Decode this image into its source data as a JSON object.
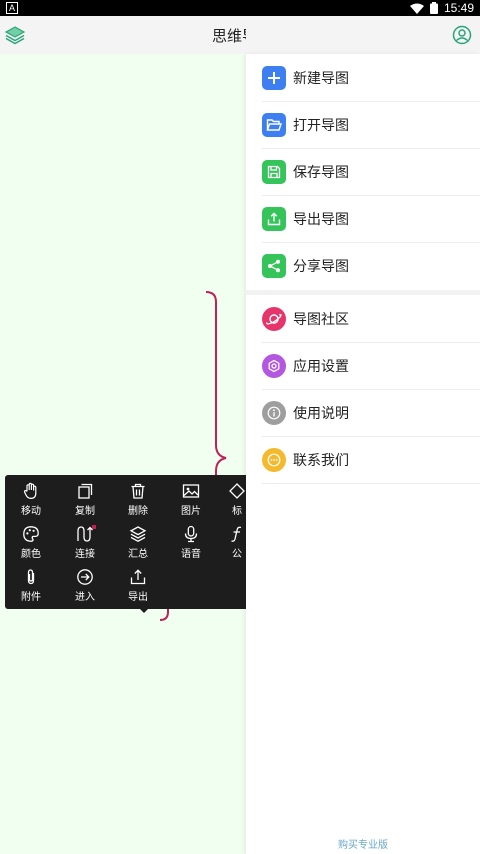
{
  "status_bar": {
    "left_badge": "A",
    "time": "15:49"
  },
  "app_bar": {
    "title": "思维导图",
    "left_icon": "layers-icon",
    "right_icon": "user-icon"
  },
  "toolbar": {
    "items": [
      {
        "label": "移动",
        "icon": "hand-icon"
      },
      {
        "label": "复制",
        "icon": "copy-icon"
      },
      {
        "label": "删除",
        "icon": "trash-icon"
      },
      {
        "label": "图片",
        "icon": "image-icon"
      },
      {
        "label": "标",
        "icon": "tag-icon"
      },
      {
        "label": "颜色",
        "icon": "palette-icon"
      },
      {
        "label": "连接",
        "icon": "connect-icon"
      },
      {
        "label": "汇总",
        "icon": "summary-icon"
      },
      {
        "label": "语音",
        "icon": "mic-icon"
      },
      {
        "label": "公",
        "icon": "formula-icon"
      },
      {
        "label": "附件",
        "icon": "paperclip-icon"
      },
      {
        "label": "进入",
        "icon": "enter-icon"
      },
      {
        "label": "导出",
        "icon": "export-icon"
      }
    ]
  },
  "drawer": {
    "menu_group_1": [
      {
        "label": "新建导图",
        "icon": "plus-icon",
        "color": "#3d7ff0"
      },
      {
        "label": "打开导图",
        "icon": "folder-open-icon",
        "color": "#3d7ff0"
      },
      {
        "label": "保存导图",
        "icon": "save-icon",
        "color": "#34c45a"
      },
      {
        "label": "导出导图",
        "icon": "upload-icon",
        "color": "#34c45a"
      },
      {
        "label": "分享导图",
        "icon": "share-icon",
        "color": "#34c45a"
      }
    ],
    "menu_group_2": [
      {
        "label": "导图社区",
        "icon": "planet-icon",
        "color": "#e6356a"
      },
      {
        "label": "应用设置",
        "icon": "settings-icon",
        "color": "#b356e0"
      },
      {
        "label": "使用说明",
        "icon": "info-icon",
        "color": "#9e9e9e"
      },
      {
        "label": "联系我们",
        "icon": "chat-icon",
        "color": "#f4b92c"
      }
    ],
    "footer_link": "购买专业版"
  }
}
